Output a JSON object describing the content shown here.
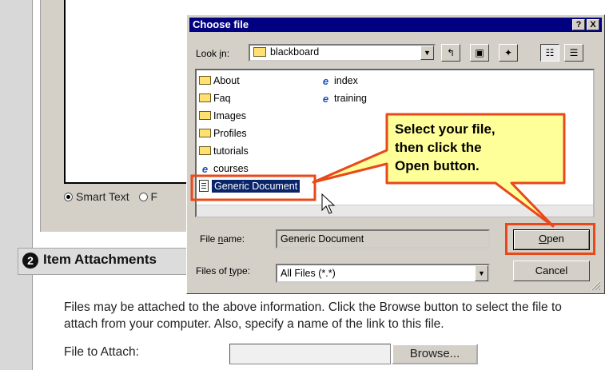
{
  "background_page": {
    "radio_options": [
      {
        "label": "Smart Text",
        "selected": true
      },
      {
        "label": "F",
        "selected": false
      }
    ],
    "section_number": "2",
    "section_title": "Item Attachments",
    "description": "Files may be attached to the above information. Click the Browse button to select the file to attach from your computer. Also, specify a name of the link to this file.",
    "file_to_attach_label": "File to Attach:",
    "file_to_attach_value": "",
    "browse_label": "Browse..."
  },
  "dialog": {
    "title": "Choose file",
    "help_glyph": "?",
    "close_glyph": "X",
    "look_in_label_pre": "Look ",
    "look_in_label_key": "i",
    "look_in_label_post": "n:",
    "look_in_value": "blackboard",
    "toolbar_icons": [
      "up-one-level-icon",
      "desktop-icon",
      "new-folder-icon",
      "list-view-icon",
      "details-view-icon"
    ],
    "files_col1": [
      {
        "name": "About",
        "type": "folder"
      },
      {
        "name": "Faq",
        "type": "folder"
      },
      {
        "name": "Images",
        "type": "folder"
      },
      {
        "name": "Profiles",
        "type": "folder"
      },
      {
        "name": "tutorials",
        "type": "folder"
      },
      {
        "name": "courses",
        "type": "web"
      }
    ],
    "files_col2": [
      {
        "name": "index",
        "type": "web"
      },
      {
        "name": "training",
        "type": "web"
      }
    ],
    "selected_file": "Generic Document",
    "file_name_label_pre": "File ",
    "file_name_label_key": "n",
    "file_name_label_post": "ame:",
    "file_name_value": "Generic Document",
    "files_of_type_label_pre": "Files of ",
    "files_of_type_label_key": "t",
    "files_of_type_label_post": "ype:",
    "files_of_type_value": "All Files (*.*)",
    "open_label_key": "O",
    "open_label_rest": "pen",
    "cancel_label": "Cancel"
  },
  "callout": {
    "lines": [
      "Select your file,",
      "then click the",
      "Open button."
    ],
    "fill_color": "#ffff99",
    "border_color": "#e8481a"
  }
}
